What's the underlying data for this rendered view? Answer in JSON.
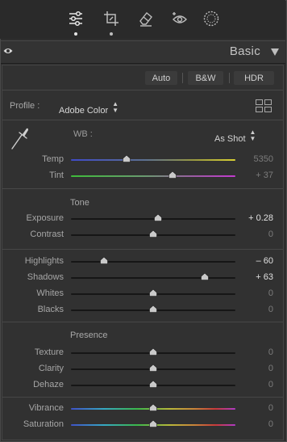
{
  "toolstrip": {
    "tools": [
      {
        "name": "edit-sliders",
        "active": true
      },
      {
        "name": "crop",
        "active": false
      },
      {
        "name": "healing",
        "active": false
      },
      {
        "name": "red-eye",
        "active": false
      },
      {
        "name": "masking",
        "active": false
      }
    ]
  },
  "header": {
    "title": "Basic"
  },
  "buttons": {
    "auto": "Auto",
    "bw": "B&W",
    "hdr": "HDR"
  },
  "profile": {
    "label": "Profile :",
    "value": "Adobe Color"
  },
  "wb": {
    "label": "WB :",
    "value": "As Shot"
  },
  "tone": {
    "label": "Tone"
  },
  "presence": {
    "label": "Presence"
  },
  "sliders": {
    "temp": {
      "label": "Temp",
      "display": "5350",
      "position": 0.34,
      "bright": false
    },
    "tint": {
      "label": "Tint",
      "display": "+ 37",
      "position": 0.62,
      "bright": false
    },
    "exposure": {
      "label": "Exposure",
      "display": "+ 0.28",
      "position": 0.53,
      "bright": true
    },
    "contrast": {
      "label": "Contrast",
      "display": "0",
      "position": 0.5,
      "bright": false
    },
    "highlights": {
      "label": "Highlights",
      "display": "– 60",
      "position": 0.2,
      "bright": true
    },
    "shadows": {
      "label": "Shadows",
      "display": "+ 63",
      "position": 0.815,
      "bright": true
    },
    "whites": {
      "label": "Whites",
      "display": "0",
      "position": 0.5,
      "bright": false
    },
    "blacks": {
      "label": "Blacks",
      "display": "0",
      "position": 0.5,
      "bright": false
    },
    "texture": {
      "label": "Texture",
      "display": "0",
      "position": 0.5,
      "bright": false
    },
    "clarity": {
      "label": "Clarity",
      "display": "0",
      "position": 0.5,
      "bright": false
    },
    "dehaze": {
      "label": "Dehaze",
      "display": "0",
      "position": 0.5,
      "bright": false
    },
    "vibrance": {
      "label": "Vibrance",
      "display": "0",
      "position": 0.5,
      "bright": false
    },
    "saturation": {
      "label": "Saturation",
      "display": "0",
      "position": 0.5,
      "bright": false
    }
  },
  "colors": {
    "panel_bg": "#313131",
    "text": "#a6a6a6",
    "value_bright": "#e0e0e0",
    "value_dim": "#7c7c7c"
  }
}
